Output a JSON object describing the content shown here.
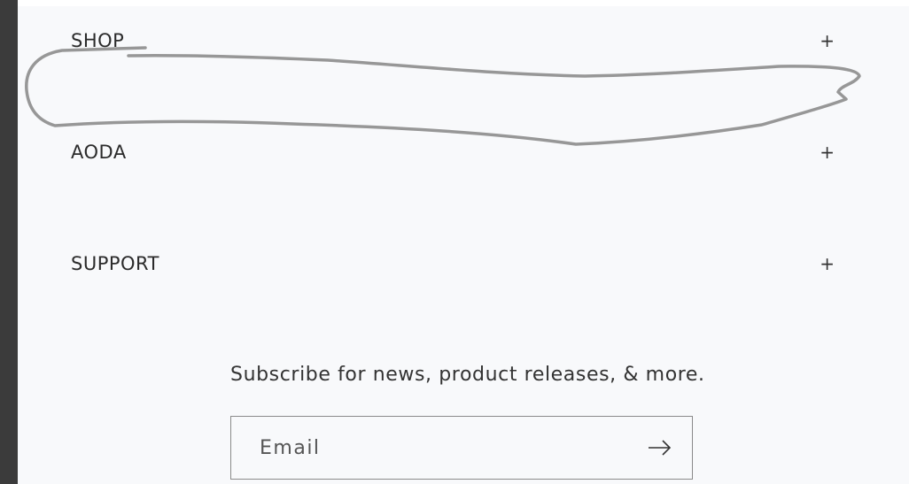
{
  "footer": {
    "accordion": [
      {
        "label": "SHOP",
        "toggle": "+"
      },
      {
        "label": "AODA",
        "toggle": "+"
      },
      {
        "label": "SUPPORT",
        "toggle": "+"
      }
    ],
    "newsletter": {
      "heading": "Subscribe for news, product releases, & more.",
      "email_placeholder": "Email",
      "email_value": "",
      "submit_icon": "arrow-right-icon"
    }
  },
  "colors": {
    "panel_background": "#f8f9fb",
    "left_bar": "#3b3b3b",
    "scribble": "#8c8c8c"
  }
}
